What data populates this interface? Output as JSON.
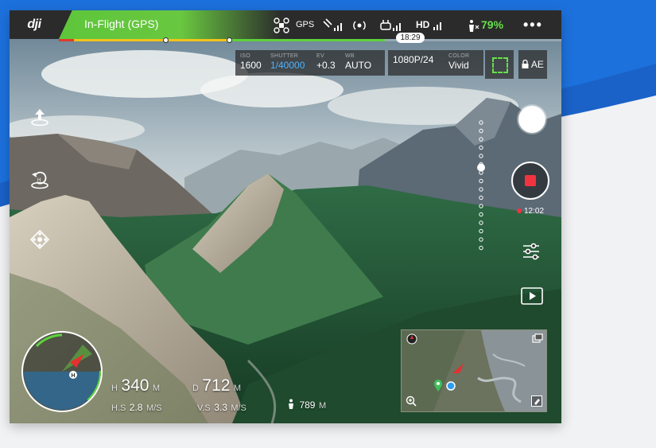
{
  "app": {
    "logo_text": "dji",
    "flight_status": "In-Flight (GPS)"
  },
  "topbar": {
    "gps_label": "GPS",
    "hd_label": "HD",
    "battery_percent": "79%",
    "more_label": "•••",
    "flight_time": "18:29",
    "battery_level": 0.79,
    "battery_red_fraction": 0.03,
    "battery_yellow_fraction": 0.31,
    "colors": {
      "green": "#66e04a",
      "red": "#e03a2d",
      "yellow": "#f2c31a"
    }
  },
  "camera": {
    "iso_label": "ISO",
    "iso_value": "1600",
    "shutter_label": "SHUTTER",
    "shutter_value": "1/40000",
    "ev_label": "EV",
    "ev_value": "+0.3",
    "wb_label": "WB",
    "wb_value": "AUTO",
    "format_label": "",
    "format_value": "1080P/24",
    "color_label": "COLOR",
    "color_value": "Vivid",
    "ae_label": "AE"
  },
  "left_tools": [
    {
      "name": "takeoff-icon"
    },
    {
      "name": "return-home-icon"
    },
    {
      "name": "intelligent-flight-icon"
    }
  ],
  "recording": {
    "time": "12:02",
    "accent": "#f0333e"
  },
  "telemetry": {
    "h_label": "H",
    "h_value": "340",
    "h_unit": "M",
    "d_label": "D",
    "d_value": "712",
    "d_unit": "M",
    "hs_label": "H.S",
    "hs_value": "2.8",
    "hs_unit": "M/S",
    "vs_label": "V.S",
    "vs_value": "3.3",
    "vs_unit": "M/S",
    "alt_value": "789",
    "alt_unit": "M"
  },
  "radar": {
    "home_label": "H"
  },
  "gimbal": {
    "level": 0.36
  }
}
